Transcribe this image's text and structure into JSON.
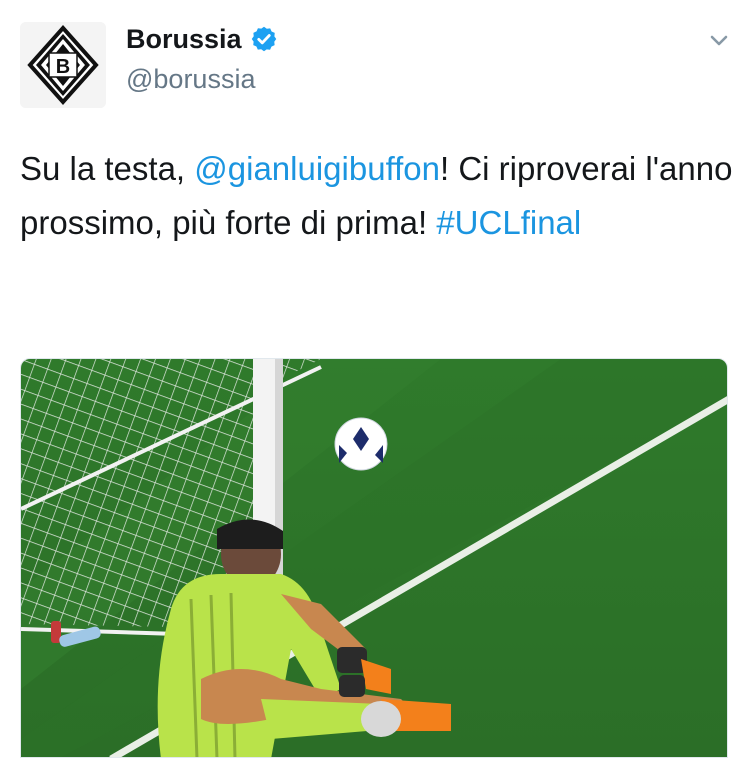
{
  "tweet": {
    "display_name": "Borussia",
    "handle": "@borussia",
    "verified": true,
    "text_before": "Su la testa, ",
    "mention": "@gianluigibuffon",
    "text_after": "! Ci riproverai l'anno prossimo, più forte di prima! ",
    "hashtag": "#UCLfinal"
  },
  "avatar": {
    "logo_letter": "B",
    "icon": "borussia-logo"
  },
  "media": {
    "description_icon": "photo-goalkeeper-sitting"
  },
  "colors": {
    "link": "#1b95e0",
    "verified": "#1da1f2",
    "pitch": "#2f7d2a",
    "jersey": "#b9e34a"
  }
}
